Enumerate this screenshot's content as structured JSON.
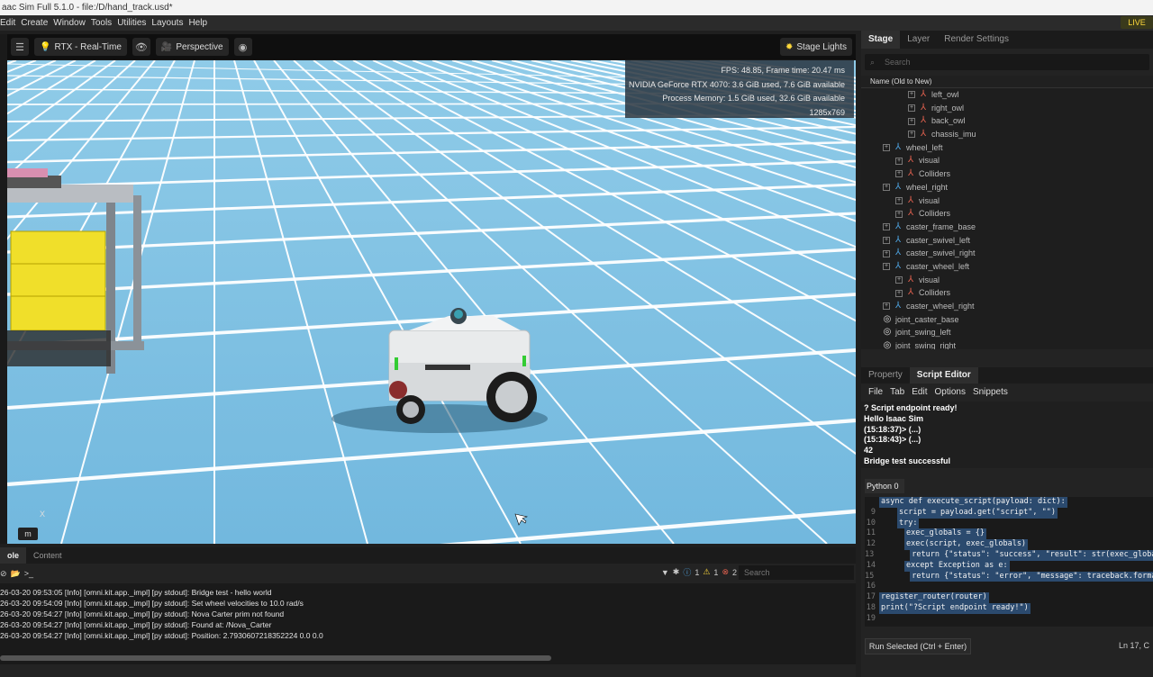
{
  "window": {
    "title": "aac Sim Full 5.1.0 - file:/D/hand_track.usd*",
    "live_label": "LIVE"
  },
  "menu": [
    "Edit",
    "Create",
    "Window",
    "Tools",
    "Utilities",
    "Layouts",
    "Help"
  ],
  "viewport": {
    "render_mode": "RTX - Real-Time",
    "camera": "Perspective",
    "stage_lights": "Stage Lights",
    "hud": {
      "fps": "FPS: 48.85, Frame time: 20.47 ms",
      "gpu": "NVIDIA GeForce RTX 4070: 3.6 GiB used, 7.6 GiB available",
      "memory": "Process Memory: 1.5 GiB used, 32.6 GiB available",
      "resolution": "1285x769"
    },
    "unit_button": "m",
    "axis_x": "X"
  },
  "stage": {
    "tabs": [
      "Stage",
      "Layer",
      "Render Settings"
    ],
    "search_placeholder": "Search",
    "column_header": "Name (Old to New)",
    "items": [
      {
        "label": "left_owl",
        "indent": 3,
        "icon": "joint-red",
        "expand": true
      },
      {
        "label": "right_owl",
        "indent": 3,
        "icon": "joint-red",
        "expand": true
      },
      {
        "label": "back_owl",
        "indent": 3,
        "icon": "joint-red",
        "expand": true
      },
      {
        "label": "chassis_imu",
        "indent": 3,
        "icon": "joint-red",
        "expand": true
      },
      {
        "label": "wheel_left",
        "indent": 1,
        "icon": "xform",
        "expand": true
      },
      {
        "label": "visual",
        "indent": 2,
        "icon": "joint-red",
        "expand": true
      },
      {
        "label": "Colliders",
        "indent": 2,
        "icon": "joint-red",
        "expand": true
      },
      {
        "label": "wheel_right",
        "indent": 1,
        "icon": "xform",
        "expand": true
      },
      {
        "label": "visual",
        "indent": 2,
        "icon": "joint-red",
        "expand": true
      },
      {
        "label": "Colliders",
        "indent": 2,
        "icon": "joint-red",
        "expand": true
      },
      {
        "label": "caster_frame_base",
        "indent": 1,
        "icon": "xform",
        "expand": true
      },
      {
        "label": "caster_swivel_left",
        "indent": 1,
        "icon": "xform",
        "expand": true
      },
      {
        "label": "caster_swivel_right",
        "indent": 1,
        "icon": "xform",
        "expand": true
      },
      {
        "label": "caster_wheel_left",
        "indent": 1,
        "icon": "xform",
        "expand": true
      },
      {
        "label": "visual",
        "indent": 2,
        "icon": "joint-red",
        "expand": true
      },
      {
        "label": "Colliders",
        "indent": 2,
        "icon": "joint-red",
        "expand": true
      },
      {
        "label": "caster_wheel_right",
        "indent": 1,
        "icon": "xform",
        "expand": true
      },
      {
        "label": "joint_caster_base",
        "indent": 1,
        "icon": "joint",
        "expand": false
      },
      {
        "label": "joint_swing_left",
        "indent": 1,
        "icon": "joint",
        "expand": false
      },
      {
        "label": "joint_swing_right",
        "indent": 1,
        "icon": "joint",
        "expand": false
      }
    ]
  },
  "property_tabs": [
    "Property",
    "Script Editor"
  ],
  "script_menu": [
    "File",
    "Tab",
    "Edit",
    "Options",
    "Snippets"
  ],
  "script_output": [
    "? Script endpoint ready!",
    "Hello Isaac Sim",
    "(15:18:37)> (...)",
    "(15:18:43)> (...)",
    "42",
    "Bridge test successful"
  ],
  "python_tab": "Python 0",
  "code_lines": [
    {
      "n": "",
      "t": "async def execute_script(payload: dict):"
    },
    {
      "n": "9",
      "t": "script = payload.get(\"script\", \"\")"
    },
    {
      "n": "10",
      "t": "try:"
    },
    {
      "n": "11",
      "t": "exec_globals = {}"
    },
    {
      "n": "12",
      "t": "exec(script, exec_globals)"
    },
    {
      "n": "13",
      "t": "return {\"status\": \"success\", \"result\": str(exec_globals.get(\"result\", \""
    },
    {
      "n": "14",
      "t": "except Exception as e:"
    },
    {
      "n": "15",
      "t": "return {\"status\": \"error\", \"message\": traceback.format_exc()}"
    },
    {
      "n": "16",
      "t": ""
    },
    {
      "n": "17",
      "t": "register_router(router)"
    },
    {
      "n": "18",
      "t": "print(\"?Script endpoint ready!\")"
    },
    {
      "n": "19",
      "t": ""
    }
  ],
  "run_button": "Run Selected (Ctrl + Enter)",
  "cursor_pos": "Ln 17, C",
  "console": {
    "tabs": [
      "ole",
      "Content"
    ],
    "search_placeholder": "Search",
    "info_count": "1",
    "warn_count": "1",
    "error_count": "2",
    "lines": [
      "26-03-20 09:53:05  [Info] [omni.kit.app._impl] [py stdout]: Bridge test - hello world",
      "26-03-20 09:54:09  [Info] [omni.kit.app._impl] [py stdout]: Set wheel velocities to 10.0 rad/s",
      "26-03-20 09:54:27  [Info] [omni.kit.app._impl] [py stdout]: Nova Carter prim not found",
      "26-03-20 09:54:27  [Info] [omni.kit.app._impl] [py stdout]: Found at: /Nova_Carter",
      "26-03-20 09:54:27  [Info] [omni.kit.app._impl] [py stdout]: Position: 2.7930607218352224 0.0 0.0"
    ]
  },
  "colors": {
    "floor": "#7ec3e4",
    "grid": "#ffffff",
    "accent": "#4ea3e0"
  }
}
